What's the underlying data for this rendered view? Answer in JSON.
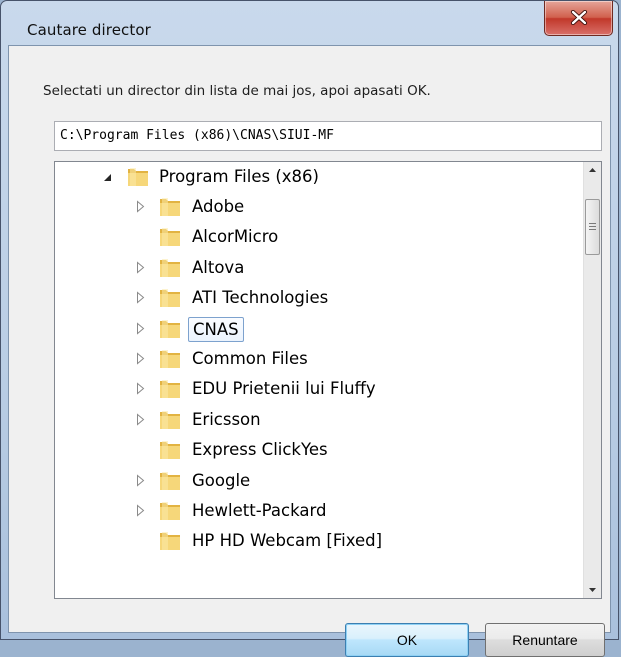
{
  "window": {
    "title": "Cautare director",
    "close_icon": "close-icon"
  },
  "dialog": {
    "instruction": "Selectati un director din lista de mai jos, apoi apasati OK.",
    "path_value": "C:\\Program Files (x86)\\CNAS\\SIUI-MF"
  },
  "tree": {
    "root": {
      "label": "Program Files (x86)",
      "expanded": true
    },
    "items": [
      {
        "label": "Adobe",
        "has_children": true,
        "selected": false
      },
      {
        "label": "AlcorMicro",
        "has_children": false,
        "selected": false
      },
      {
        "label": "Altova",
        "has_children": true,
        "selected": false
      },
      {
        "label": "ATI Technologies",
        "has_children": true,
        "selected": false
      },
      {
        "label": "CNAS",
        "has_children": true,
        "selected": true
      },
      {
        "label": "Common Files",
        "has_children": true,
        "selected": false
      },
      {
        "label": "EDU Prietenii lui Fluffy",
        "has_children": true,
        "selected": false
      },
      {
        "label": "Ericsson",
        "has_children": true,
        "selected": false
      },
      {
        "label": "Express ClickYes",
        "has_children": false,
        "selected": false
      },
      {
        "label": "Google",
        "has_children": true,
        "selected": false
      },
      {
        "label": "Hewlett-Packard",
        "has_children": true,
        "selected": false
      },
      {
        "label": "HP HD Webcam [Fixed]",
        "has_children": false,
        "selected": false
      }
    ]
  },
  "buttons": {
    "ok_label": "OK",
    "cancel_label": "Renuntare"
  },
  "colors": {
    "selection_border": "#7da2ce",
    "close_button": "#c1382a",
    "ok_default_border": "#3c7fb1"
  }
}
